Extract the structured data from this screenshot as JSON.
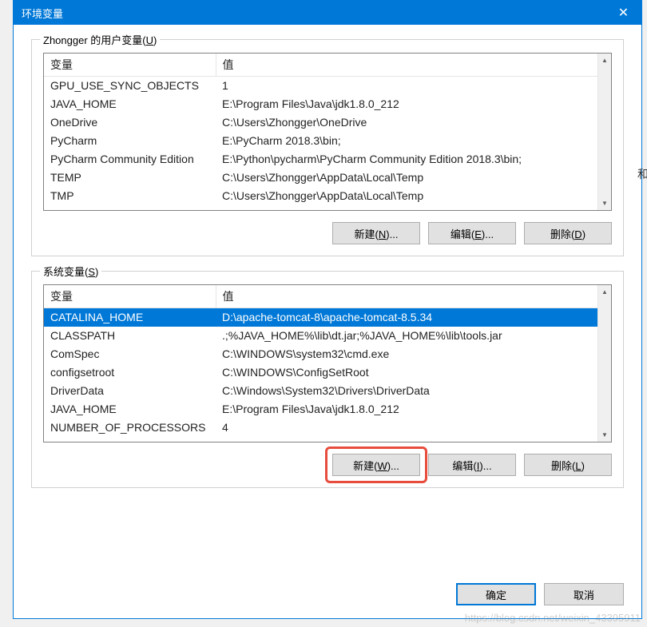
{
  "window": {
    "title": "环境变量",
    "close_label": "✕"
  },
  "user_section": {
    "label_prefix": "Zhongger 的用户变量(",
    "label_hotkey": "U",
    "label_suffix": ")",
    "col_var": "变量",
    "col_val": "值",
    "rows": [
      {
        "name": "GPU_USE_SYNC_OBJECTS",
        "value": "1"
      },
      {
        "name": "JAVA_HOME",
        "value": "E:\\Program Files\\Java\\jdk1.8.0_212"
      },
      {
        "name": "OneDrive",
        "value": "C:\\Users\\Zhongger\\OneDrive"
      },
      {
        "name": "PyCharm",
        "value": "E:\\PyCharm 2018.3\\bin;"
      },
      {
        "name": "PyCharm Community Edition",
        "value": "E:\\Python\\pycharm\\PyCharm Community Edition 2018.3\\bin;"
      },
      {
        "name": "TEMP",
        "value": "C:\\Users\\Zhongger\\AppData\\Local\\Temp"
      },
      {
        "name": "TMP",
        "value": "C:\\Users\\Zhongger\\AppData\\Local\\Temp"
      }
    ],
    "buttons": {
      "new_pre": "新建(",
      "new_hot": "N",
      "new_suf": ")...",
      "edit_pre": "编辑(",
      "edit_hot": "E",
      "edit_suf": ")...",
      "del_pre": "删除(",
      "del_hot": "D",
      "del_suf": ")"
    }
  },
  "system_section": {
    "label_prefix": "系统变量(",
    "label_hotkey": "S",
    "label_suffix": ")",
    "col_var": "变量",
    "col_val": "值",
    "selected_index": 0,
    "rows": [
      {
        "name": "CATALINA_HOME",
        "value": "D:\\apache-tomcat-8\\apache-tomcat-8.5.34"
      },
      {
        "name": "CLASSPATH",
        "value": ".;%JAVA_HOME%\\lib\\dt.jar;%JAVA_HOME%\\lib\\tools.jar"
      },
      {
        "name": "ComSpec",
        "value": "C:\\WINDOWS\\system32\\cmd.exe"
      },
      {
        "name": "configsetroot",
        "value": "C:\\WINDOWS\\ConfigSetRoot"
      },
      {
        "name": "DriverData",
        "value": "C:\\Windows\\System32\\Drivers\\DriverData"
      },
      {
        "name": "JAVA_HOME",
        "value": "E:\\Program Files\\Java\\jdk1.8.0_212"
      },
      {
        "name": "NUMBER_OF_PROCESSORS",
        "value": "4"
      }
    ],
    "buttons": {
      "new_pre": "新建(",
      "new_hot": "W",
      "new_suf": ")...",
      "edit_pre": "编辑(",
      "edit_hot": "I",
      "edit_suf": ")...",
      "del_pre": "删除(",
      "del_hot": "L",
      "del_suf": ")"
    }
  },
  "footer": {
    "ok": "确定",
    "cancel": "取消"
  },
  "edge_text": "和",
  "watermark": "https://blog.csdn.net/weixin_43395911"
}
